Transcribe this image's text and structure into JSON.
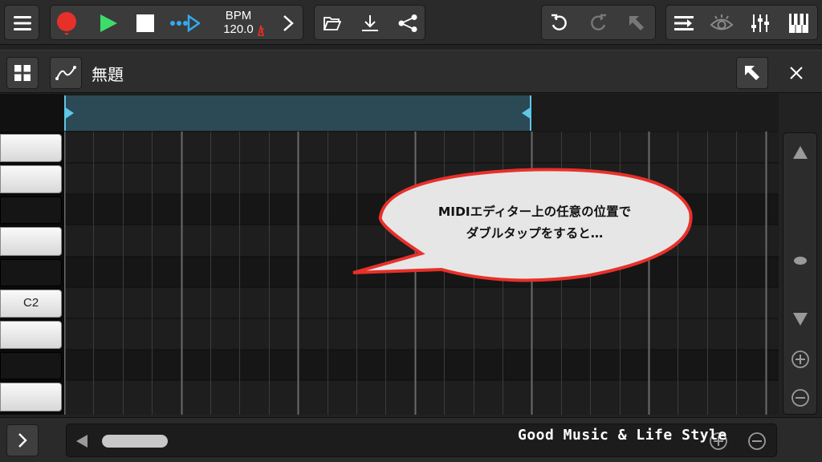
{
  "toolbar": {
    "bpm_label": "BPM",
    "bpm_value": "120.0",
    "icons": [
      "menu-icon",
      "record-icon",
      "play-icon",
      "stop-icon",
      "loop-icon",
      "chevron-right-icon",
      "folder-icon",
      "download-icon",
      "share-icon",
      "undo-icon",
      "redo-icon",
      "pointer-icon",
      "mixer-list-icon",
      "eye-icon",
      "sliders-icon",
      "piano-icon"
    ],
    "colors": {
      "record": "#e8302a",
      "play": "#3ddc6b",
      "loop": "#33aaf0"
    }
  },
  "header": {
    "title": "無題",
    "icons": [
      "grid-icon",
      "automation-curve-icon",
      "select-arrow-icon",
      "close-icon"
    ]
  },
  "editor": {
    "key_label_c2": "C2",
    "loop_region_color": "#2b4a55",
    "loop_marker_color": "#5fc6e8"
  },
  "callout": {
    "line1": "MIDIエディター上の任意の位置で",
    "line2": "ダブルタップをすると…",
    "border_color": "#e8302a"
  },
  "bottom": {
    "watermark": "Good Music & Life Style"
  }
}
